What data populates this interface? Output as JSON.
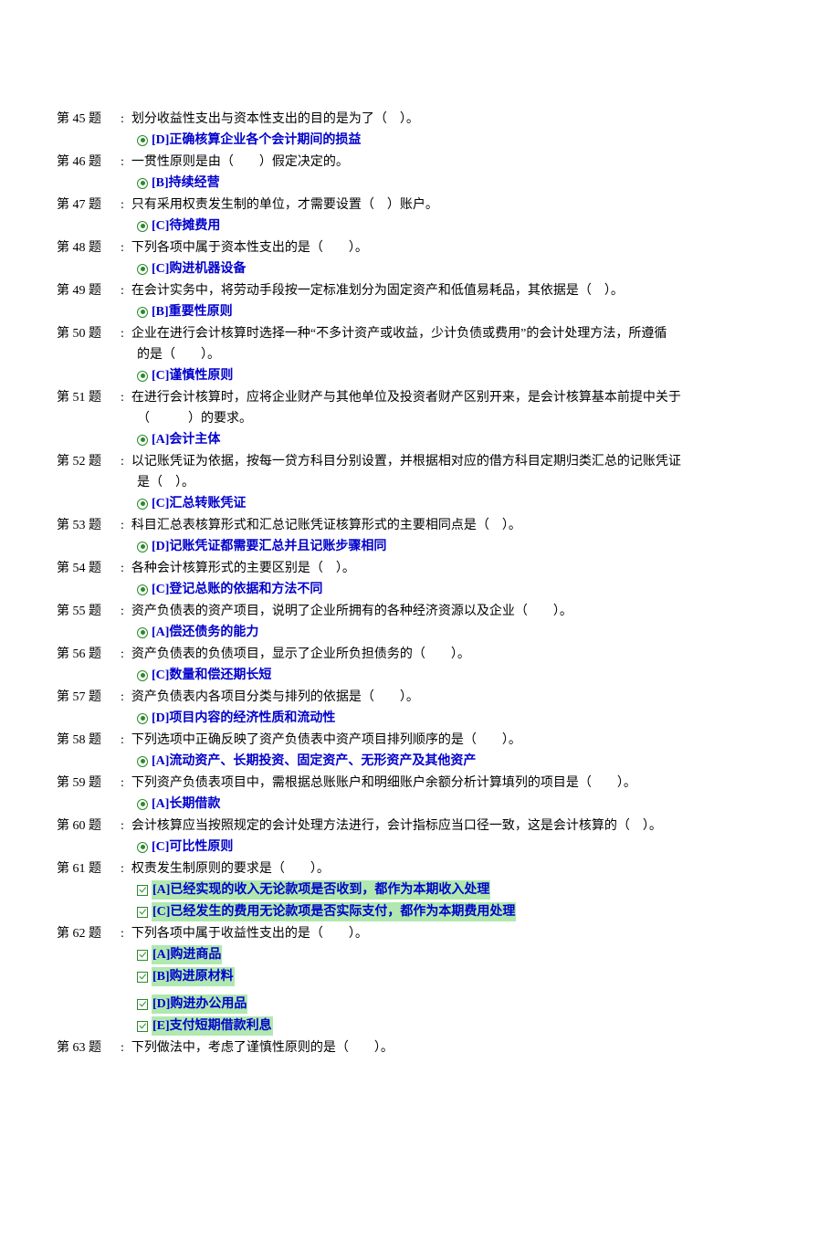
{
  "questions": [
    {
      "num": "第 45 题",
      "text": "划分收益性支出与资本性支出的目的是为了（　）。",
      "answers": [
        {
          "type": "radio",
          "text": "[D]正确核算企业各个会计期间的损益",
          "highlight": false
        }
      ]
    },
    {
      "num": "第 46 题",
      "text": "一贯性原则是由（　　）假定决定的。",
      "answers": [
        {
          "type": "radio",
          "text": "[B]持续经营",
          "highlight": false
        }
      ]
    },
    {
      "num": "第 47 题",
      "text": "只有采用权责发生制的单位，才需要设置（　）账户。",
      "answers": [
        {
          "type": "radio",
          "text": "[C]待摊费用",
          "highlight": false
        }
      ]
    },
    {
      "num": "第 48 题",
      "text": "下列各项中属于资本性支出的是（　　）。",
      "answers": [
        {
          "type": "radio",
          "text": "[C]购进机器设备",
          "highlight": false
        }
      ]
    },
    {
      "num": "第 49 题",
      "text": "在会计实务中，将劳动手段按一定标准划分为固定资产和低值易耗品，其依据是（　）。",
      "answers": [
        {
          "type": "radio",
          "text": "[B]重要性原则",
          "highlight": false
        }
      ]
    },
    {
      "num": "第 50 题",
      "text": "企业在进行会计核算时选择一种“不多计资产或收益，少计负债或费用”的会计处理方法，所遵循",
      "continuation": "的是（　　）。",
      "answers": [
        {
          "type": "radio",
          "text": "[C]谨慎性原则",
          "highlight": false
        }
      ]
    },
    {
      "num": "第 51 题",
      "text": "在进行会计核算时，应将企业财产与其他单位及投资者财产区别开来，是会计核算基本前提中关于",
      "continuation": "（　　　）的要求。",
      "answers": [
        {
          "type": "radio",
          "text": "[A]会计主体",
          "highlight": false
        }
      ]
    },
    {
      "num": "第 52 题",
      "text": "以记账凭证为依据，按每一贷方科目分别设置，并根据相对应的借方科目定期归类汇总的记账凭证",
      "continuation": "是（　）。",
      "answers": [
        {
          "type": "radio",
          "text": "[C]汇总转账凭证",
          "highlight": false
        }
      ]
    },
    {
      "num": "第 53 题",
      "text": "科目汇总表核算形式和汇总记账凭证核算形式的主要相同点是（　）。",
      "answers": [
        {
          "type": "radio",
          "text": "[D]记账凭证都需要汇总并且记账步骤相同",
          "highlight": false
        }
      ]
    },
    {
      "num": "第 54 题",
      "text": "各种会计核算形式的主要区别是（　）。",
      "answers": [
        {
          "type": "radio",
          "text": "[C]登记总账的依据和方法不同",
          "highlight": false
        }
      ]
    },
    {
      "num": "第 55 题",
      "text": "资产负债表的资产项目，说明了企业所拥有的各种经济资源以及企业（　　）。",
      "answers": [
        {
          "type": "radio",
          "text": "[A]偿还债务的能力",
          "highlight": false
        }
      ]
    },
    {
      "num": "第 56 题",
      "text": "资产负债表的负债项目，显示了企业所负担债务的（　　）。",
      "answers": [
        {
          "type": "radio",
          "text": "[C]数量和偿还期长短",
          "highlight": false
        }
      ]
    },
    {
      "num": "第 57 题",
      "text": "资产负债表内各项目分类与排列的依据是（　　）。",
      "answers": [
        {
          "type": "radio",
          "text": "[D]项目内容的经济性质和流动性",
          "highlight": false
        }
      ]
    },
    {
      "num": "第 58 题",
      "text": "下列选项中正确反映了资产负债表中资产项目排列顺序的是（　　）。",
      "answers": [
        {
          "type": "radio",
          "text": "[A]流动资产、长期投资、固定资产、无形资产及其他资产",
          "highlight": false
        }
      ]
    },
    {
      "num": "第 59 题",
      "text": "下列资产负债表项目中，需根据总账账户和明细账户余额分析计算填列的项目是（　　）。",
      "answers": [
        {
          "type": "radio",
          "text": "[A]长期借款",
          "highlight": false
        }
      ]
    },
    {
      "num": "第 60 题",
      "text": "会计核算应当按照规定的会计处理方法进行，会计指标应当口径一致，这是会计核算的（　）。",
      "answers": [
        {
          "type": "radio",
          "text": "[C]可比性原则",
          "highlight": false
        }
      ]
    },
    {
      "num": "第 61 题",
      "text": "权责发生制原则的要求是（　　）。",
      "answers": [
        {
          "type": "checkbox",
          "text": "[A]已经实现的收入无论款项是否收到，都作为本期收入处理",
          "highlight": true
        },
        {
          "type": "checkbox",
          "text": "[C]已经发生的费用无论款项是否实际支付，都作为本期费用处理",
          "highlight": true
        }
      ]
    },
    {
      "num": "第 62 题",
      "text": "下列各项中属于收益性支出的是（　　）。",
      "answers": [
        {
          "type": "checkbox",
          "text": "[A]购进商品",
          "highlight": true
        },
        {
          "type": "checkbox",
          "text": "[B]购进原材料",
          "highlight": true
        },
        {
          "type": "spacer"
        },
        {
          "type": "checkbox",
          "text": "[D]购进办公用品",
          "highlight": true
        },
        {
          "type": "checkbox",
          "text": "[E]支付短期借款利息",
          "highlight": true
        }
      ]
    },
    {
      "num": "第 63 题",
      "text": "下列做法中，考虑了谨慎性原则的是（　　）。",
      "answers": []
    }
  ]
}
